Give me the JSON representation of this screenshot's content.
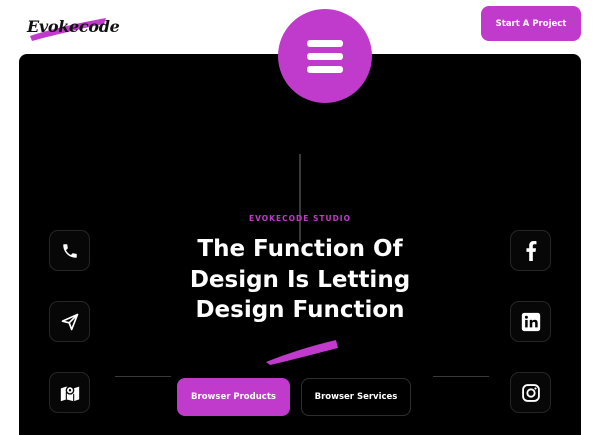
{
  "brand": {
    "logo_text": "Evokecode",
    "accent": "#c03acb"
  },
  "header": {
    "cta_label": "Start A Project"
  },
  "hero": {
    "menu_icon": "hamburger-menu-icon",
    "eyebrow": "EVOKECODE STUDIO",
    "headline_lines": [
      "The Function Of",
      "Design Is Letting",
      "Design Function"
    ],
    "primary_button": "Browser Products",
    "secondary_button": "Browser Services"
  },
  "contact_links": [
    {
      "icon": "phone-icon"
    },
    {
      "icon": "paper-plane-icon"
    },
    {
      "icon": "map-icon"
    }
  ],
  "social_links": [
    {
      "icon": "facebook-icon"
    },
    {
      "icon": "linkedin-icon"
    },
    {
      "icon": "instagram-icon"
    }
  ]
}
